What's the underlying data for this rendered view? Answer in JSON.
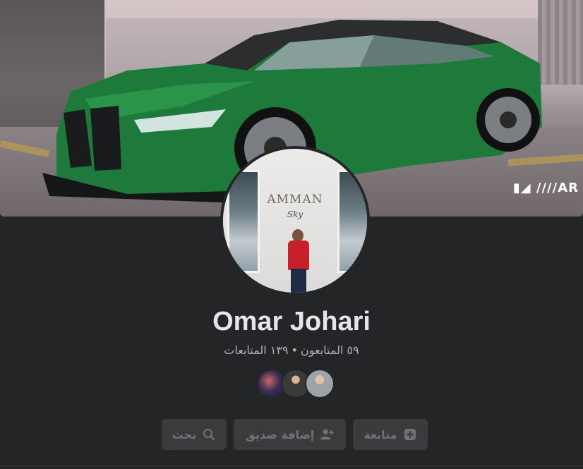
{
  "profile": {
    "name": "Omar Johari",
    "followers": "٥٩ المتابعون",
    "separator": "•",
    "following": "١٣٩ المتابعات"
  },
  "cover": {
    "logo_text": "▮◢ ////AR"
  },
  "avatar_sign": {
    "main": "AMMAN",
    "sub": "Sky"
  },
  "actions": {
    "follow_label": "متابعة",
    "add_friend_label": "إضافة صديق",
    "search_label": "بحث"
  },
  "icons": {
    "follow": "follow-icon",
    "add_friend": "add-friend-icon",
    "search": "search-icon"
  },
  "colors": {
    "background": "#242526",
    "name_text": "#e4e6eb",
    "secondary_text": "#b0b3b8",
    "button_bg": "#3a3b3c",
    "button_text": "#6f7174"
  }
}
